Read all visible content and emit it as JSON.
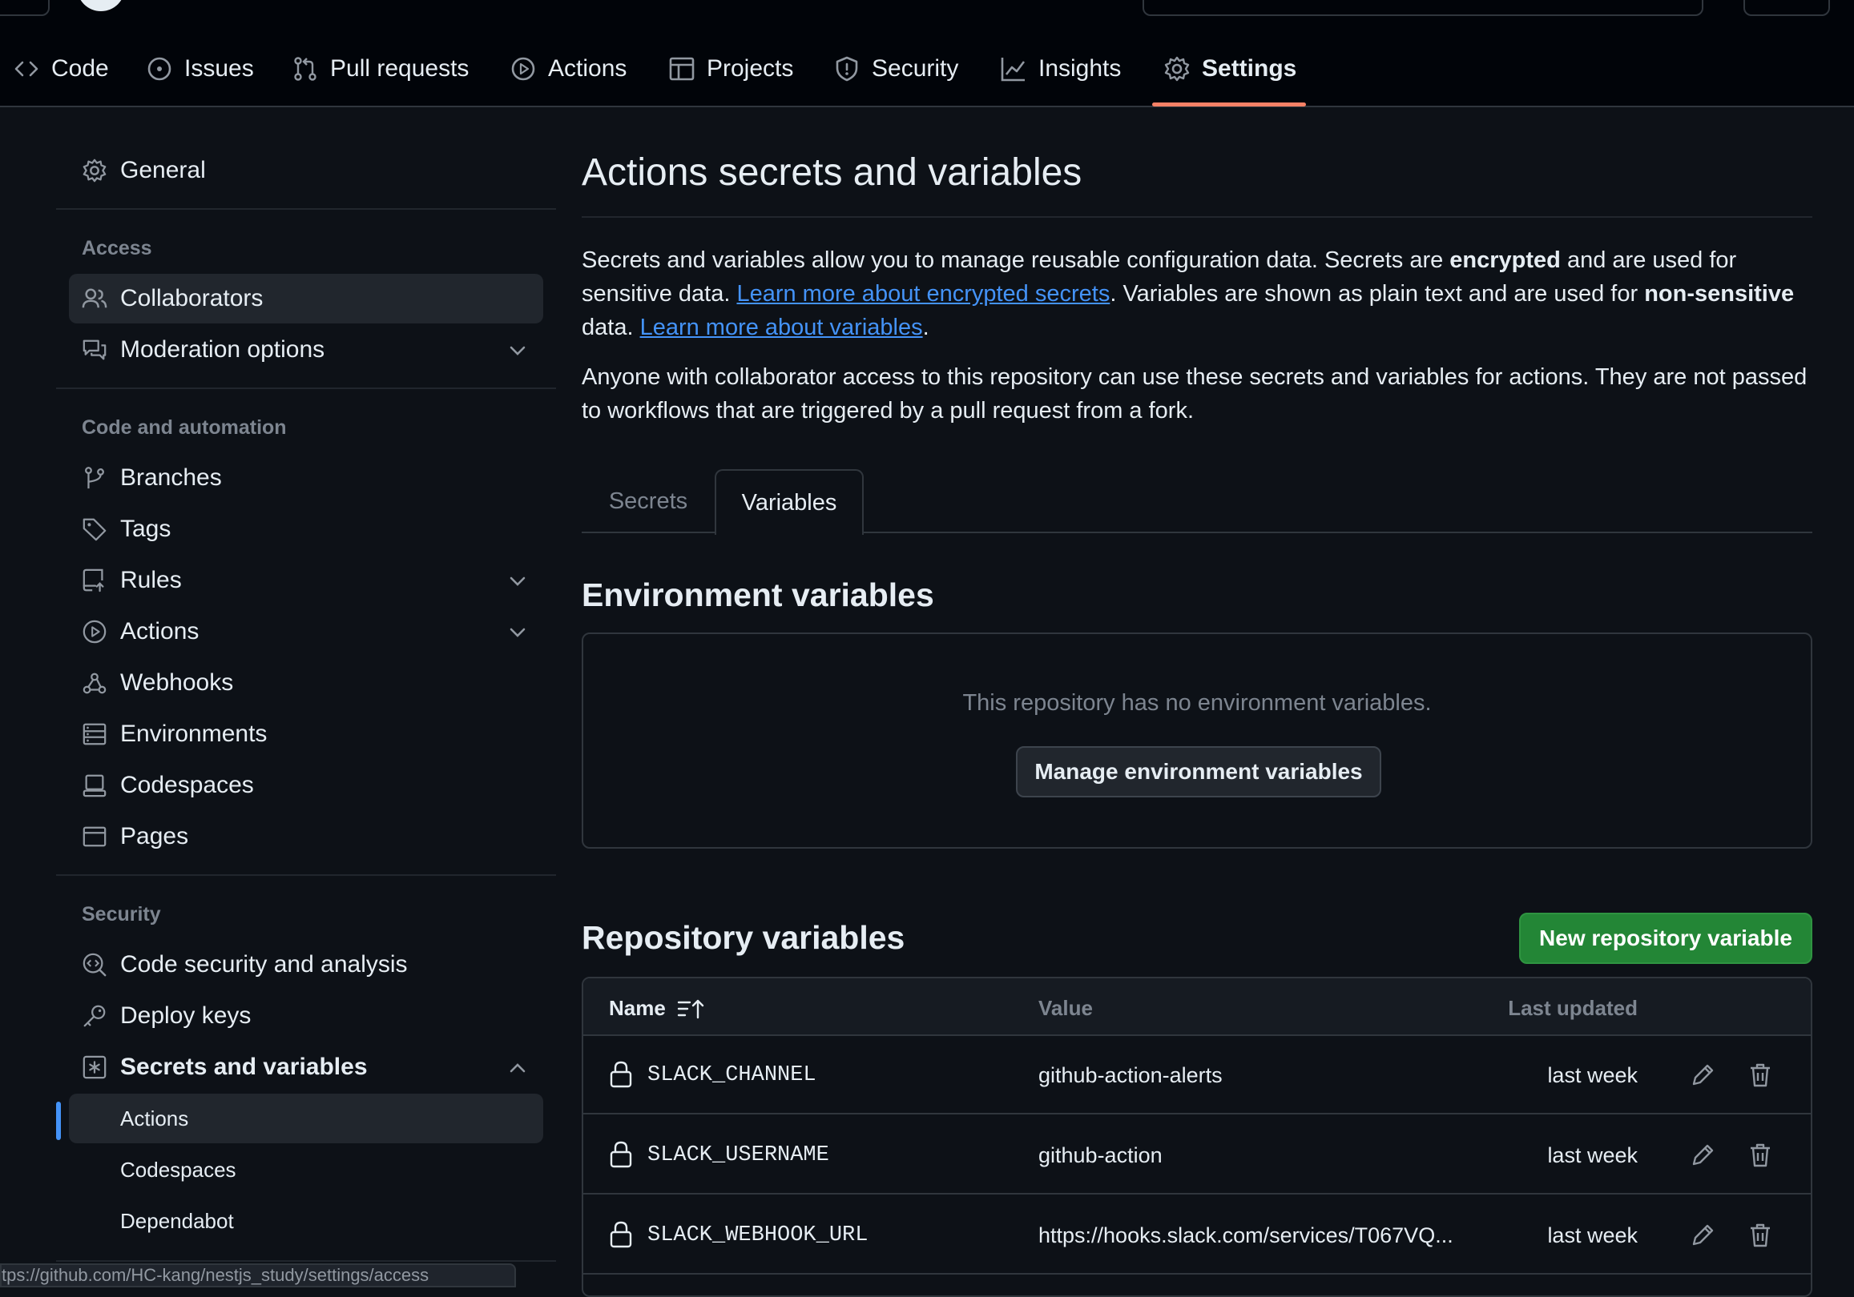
{
  "header": {
    "tabs": [
      {
        "label": "Code",
        "icon": "code-icon"
      },
      {
        "label": "Issues",
        "icon": "issue-opened-icon"
      },
      {
        "label": "Pull requests",
        "icon": "git-pull-request-icon"
      },
      {
        "label": "Actions",
        "icon": "play-icon"
      },
      {
        "label": "Projects",
        "icon": "table-icon"
      },
      {
        "label": "Security",
        "icon": "shield-icon"
      },
      {
        "label": "Insights",
        "icon": "graph-icon"
      },
      {
        "label": "Settings",
        "icon": "gear-icon",
        "active": true
      }
    ],
    "accent": "#f78166"
  },
  "sidebar": {
    "general": "General",
    "access_heading": "Access",
    "collaborators": "Collaborators",
    "moderation": "Moderation options",
    "code_heading": "Code and automation",
    "branches": "Branches",
    "tags": "Tags",
    "rules": "Rules",
    "actions": "Actions",
    "webhooks": "Webhooks",
    "environments": "Environments",
    "codespaces": "Codespaces",
    "pages": "Pages",
    "security_heading": "Security",
    "code_security": "Code security and analysis",
    "deploy_keys": "Deploy keys",
    "secrets_vars": "Secrets and variables",
    "sub_actions": "Actions",
    "sub_codespaces": "Codespaces",
    "sub_dependabot": "Dependabot",
    "selected_color": "#4493f8"
  },
  "main": {
    "title": "Actions secrets and variables",
    "intro": {
      "p1_a": "Secrets and variables allow you to manage reusable configuration data. Secrets are ",
      "p1_b": "encrypted",
      "p1_c": " and are used for sensitive data. ",
      "p1_link1": "Learn more about encrypted secrets",
      "p1_d": ". Variables are shown as plain text and are used for ",
      "p1_e": "non-sensitive",
      "p1_f": " data. ",
      "p1_link2": "Learn more about variables",
      "p1_g": ".",
      "p2": "Anyone with collaborator access to this repository can use these secrets and variables for actions. They are not passed to workflows that are triggered by a pull request from a fork."
    },
    "tabs": {
      "secrets": "Secrets",
      "variables": "Variables"
    },
    "env": {
      "title": "Environment variables",
      "empty": "This repository has no environment variables.",
      "button": "Manage environment variables"
    },
    "repo": {
      "title": "Repository variables",
      "new_button": "New repository variable",
      "columns": {
        "name": "Name",
        "value": "Value",
        "updated": "Last updated"
      },
      "rows": [
        {
          "name": "SLACK_CHANNEL",
          "value": "github-action-alerts",
          "updated": "last week"
        },
        {
          "name": "SLACK_USERNAME",
          "value": "github-action",
          "updated": "last week"
        },
        {
          "name": "SLACK_WEBHOOK_URL",
          "value": "https://hooks.slack.com/services/T067VQ...",
          "updated": "last week"
        }
      ]
    }
  },
  "status_bar": {
    "url": "tps://github.com/HC-kang/nestjs_study/settings/access"
  }
}
